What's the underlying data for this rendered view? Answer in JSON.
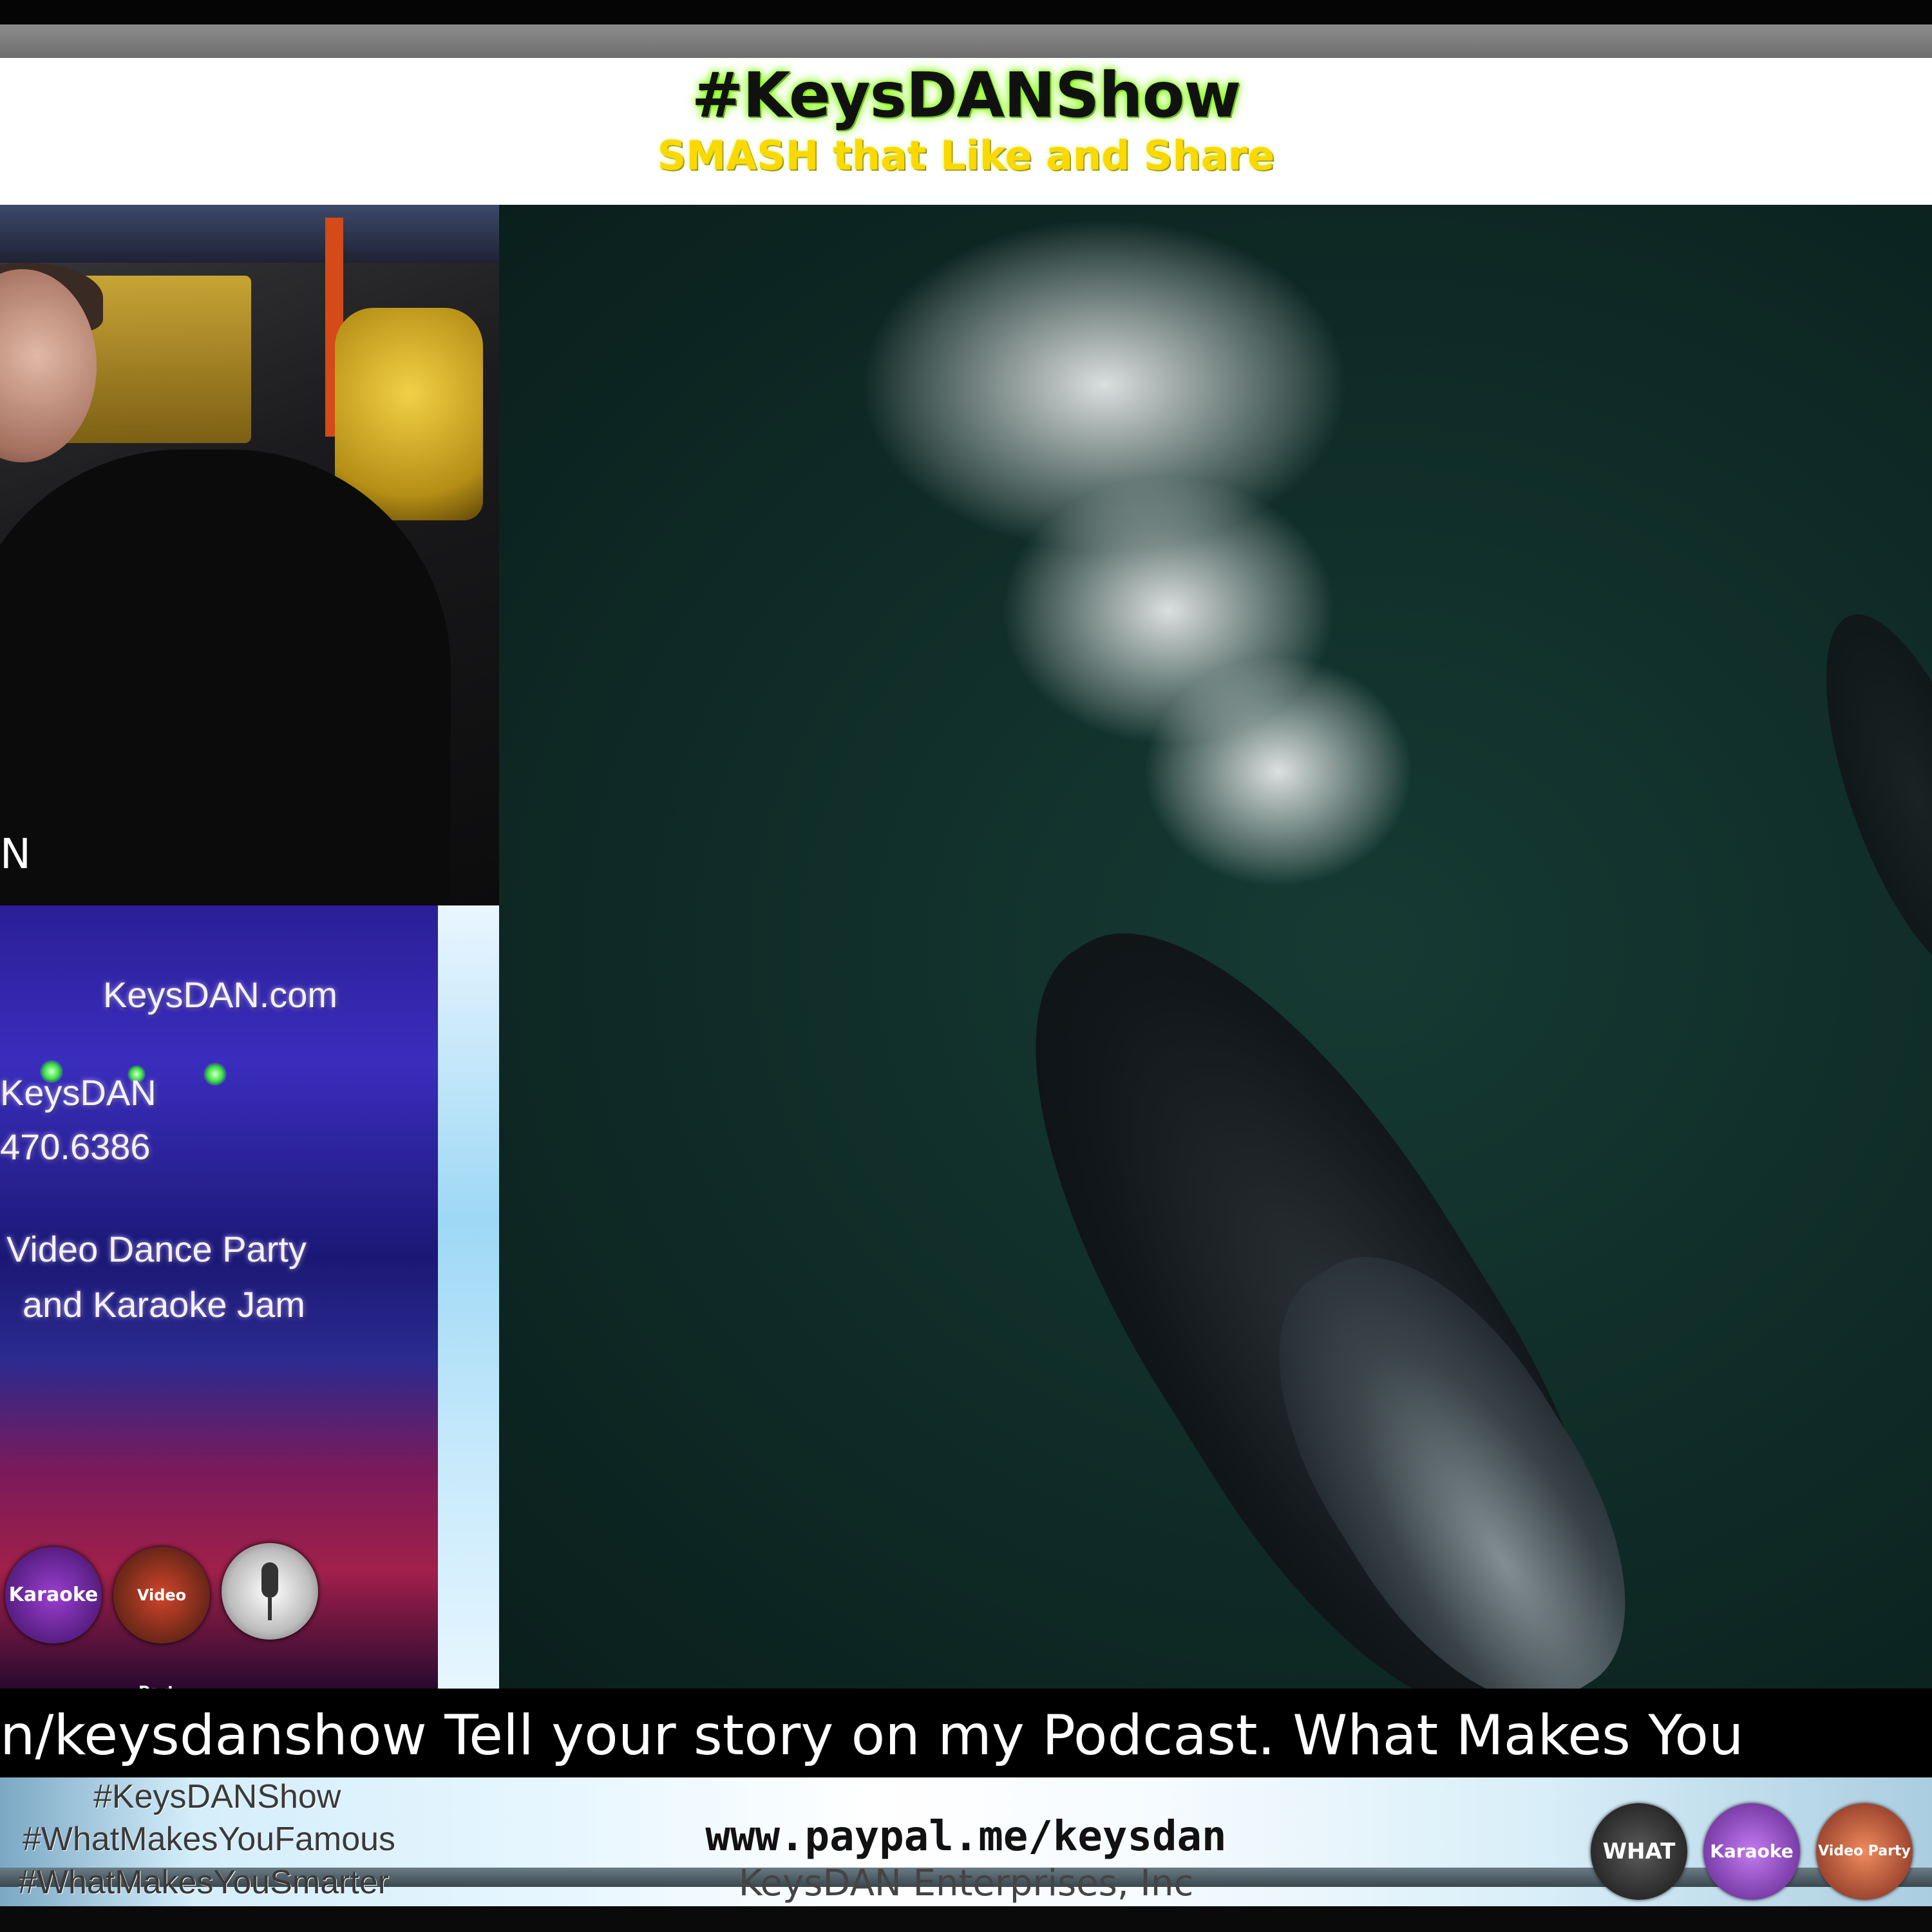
{
  "header": {
    "title": "#KeysDANShow",
    "subtitle": "SMASH that Like and Share"
  },
  "host_cam": {
    "name_fragment": "N"
  },
  "promo": {
    "website": "KeysDAN.com",
    "handle": "KeysDAN",
    "phone": "470.6386",
    "line1": "Video Dance Party",
    "line2": "and Karaoke Jam",
    "icons": [
      {
        "name": "karaoke-logo-icon",
        "label": "Karaoke",
        "color": "#9b3fd1"
      },
      {
        "name": "video-party-logo-icon",
        "label": "Video Party",
        "color": "#d2452b"
      },
      {
        "name": "microphone-singer-icon",
        "label": "",
        "color": "#e8e8e8"
      }
    ]
  },
  "ticker": {
    "text": "n/keysdanshow  Tell your story on my Podcast. What Makes You"
  },
  "footer": {
    "hashtags": [
      "#KeysDANShow",
      "#WhatMakesYouFamous",
      "#WhatMakesYouSmarter"
    ],
    "paypal": "www.paypal.me/keysdan",
    "company": "KeysDAN Enterprises, Inc",
    "logos": [
      {
        "name": "what-makes-you-logo-icon",
        "label": "WHAT",
        "color": "#2a2a2a"
      },
      {
        "name": "karaoke-logo-icon",
        "label": "Karaoke",
        "color": "#7d3fb8"
      },
      {
        "name": "video-party-logo-icon",
        "label": "Video Party",
        "color": "#c84a2c"
      }
    ]
  },
  "colors": {
    "title_glow": "#7fff00",
    "subtitle": "#ffd800",
    "ocean": "#0f2a26"
  }
}
